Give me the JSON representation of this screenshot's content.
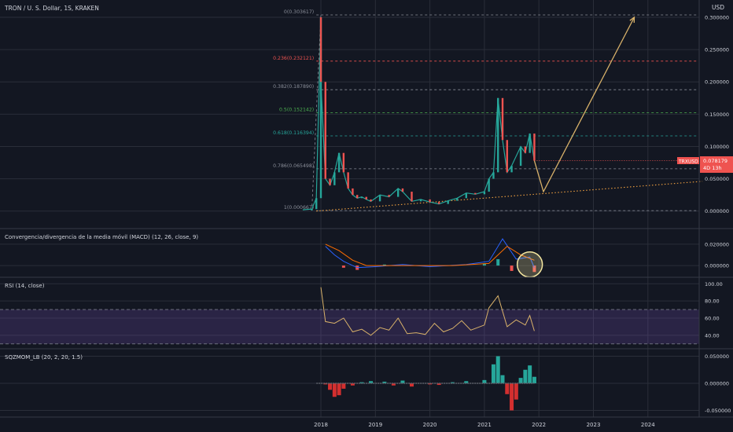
{
  "header": {
    "symbol_title": "TRON / U. S. Dollar, 1S, KRAKEN",
    "currency": "USD"
  },
  "price_badge": {
    "ticker": "TRXUSD",
    "price": "0.078179",
    "countdown": "4D 13h"
  },
  "colors": {
    "background": "#131722",
    "grid": "#2a2e39",
    "candle_up": "#26a69a",
    "candle_down": "#ef5350",
    "projection": "#d9b26a",
    "trendline": "#f0a040",
    "fib_default": "#8a8e99",
    "fib_0236": "#ef5350",
    "fib_05": "#4caf50",
    "fib_0618": "#26a69a",
    "macd_line": "#2962ff",
    "signal_line": "#ff6d00",
    "rsi_line": "#d9b26a",
    "rsi_band": "#7e57c2",
    "mom_up": "#26a69a",
    "mom_down": "#d32f2f",
    "highlight_circle": "#f5e7a0"
  },
  "chart_data": [
    {
      "type": "line",
      "pane": "price",
      "title": "TRON / U. S. Dollar, 1S, KRAKEN",
      "yaxis_ticks": [
        "0.300000",
        "0.250000",
        "0.200000",
        "0.150000",
        "0.100000",
        "0.050000",
        "0.000000"
      ],
      "ylim": [
        -0.004,
        0.3
      ],
      "x_ticks": [
        "2018",
        "2019",
        "2020",
        "2021",
        "2022",
        "2023",
        "2024"
      ],
      "fib_levels": [
        {
          "ratio": "0",
          "price": 0.303617,
          "label": "0(0.303617)",
          "color": "#8a8e99"
        },
        {
          "ratio": "0.236",
          "price": 0.232121,
          "label": "0.236(0.232121)",
          "color": "#ef5350"
        },
        {
          "ratio": "0.382",
          "price": 0.18789,
          "label": "0.382(0.187890)",
          "color": "#8a8e99"
        },
        {
          "ratio": "0.5",
          "price": 0.152142,
          "label": "0.5(0.152142)",
          "color": "#4caf50"
        },
        {
          "ratio": "0.618",
          "price": 0.116394,
          "label": "0.618(0.116394)",
          "color": "#26a69a"
        },
        {
          "ratio": "0.786",
          "price": 0.065498,
          "label": "0.786(0.065498)",
          "color": "#8a8e99"
        },
        {
          "ratio": "1",
          "price": 0.000667,
          "label": "1(0.000667)",
          "color": "#8a8e99"
        }
      ],
      "price_path": [
        [
          "2017-09",
          0.002
        ],
        [
          "2017-11",
          0.003
        ],
        [
          "2017-12",
          0.02
        ],
        [
          "2018-01",
          0.3
        ],
        [
          "2018-01",
          0.2
        ],
        [
          "2018-02",
          0.05
        ],
        [
          "2018-03",
          0.04
        ],
        [
          "2018-04",
          0.06
        ],
        [
          "2018-05",
          0.09
        ],
        [
          "2018-06",
          0.06
        ],
        [
          "2018-07",
          0.035
        ],
        [
          "2018-08",
          0.025
        ],
        [
          "2018-09",
          0.02
        ],
        [
          "2018-10",
          0.022
        ],
        [
          "2018-11",
          0.018
        ],
        [
          "2018-12",
          0.015
        ],
        [
          "2019-02",
          0.025
        ],
        [
          "2019-04",
          0.022
        ],
        [
          "2019-06",
          0.035
        ],
        [
          "2019-07",
          0.03
        ],
        [
          "2019-09",
          0.015
        ],
        [
          "2019-11",
          0.018
        ],
        [
          "2020-01",
          0.014
        ],
        [
          "2020-03",
          0.011
        ],
        [
          "2020-05",
          0.016
        ],
        [
          "2020-07",
          0.02
        ],
        [
          "2020-09",
          0.028
        ],
        [
          "2020-11",
          0.026
        ],
        [
          "2021-01",
          0.03
        ],
        [
          "2021-02",
          0.05
        ],
        [
          "2021-03",
          0.06
        ],
        [
          "2021-04",
          0.175
        ],
        [
          "2021-05",
          0.11
        ],
        [
          "2021-06",
          0.06
        ],
        [
          "2021-07",
          0.07
        ],
        [
          "2021-09",
          0.1
        ],
        [
          "2021-10",
          0.09
        ],
        [
          "2021-11",
          0.12
        ],
        [
          "2021-12",
          0.078
        ]
      ],
      "projection": [
        [
          "2021-12",
          0.078
        ],
        [
          "2022-02",
          0.03
        ],
        [
          "2023-10",
          0.3
        ]
      ],
      "trendline": [
        [
          "2017-12",
          0.0
        ],
        [
          "2025-01",
          0.046
        ]
      ],
      "last_price": 0.078179
    },
    {
      "type": "line",
      "pane": "macd",
      "title": "Convergencia/divergencia de la media móvil (MACD) (12, 26, close, 9)",
      "yaxis_ticks": [
        "0.020000",
        "0.000000"
      ],
      "ylim": [
        -0.008,
        0.028
      ],
      "series": [
        {
          "name": "MACD",
          "values": [
            [
              "2018-02",
              0.018
            ],
            [
              "2018-04",
              0.01
            ],
            [
              "2018-06",
              0.004
            ],
            [
              "2018-09",
              -0.002
            ],
            [
              "2019-01",
              -0.001
            ],
            [
              "2019-07",
              0.001
            ],
            [
              "2020-01",
              -0.001
            ],
            [
              "2020-09",
              0.001
            ],
            [
              "2021-02",
              0.004
            ],
            [
              "2021-05",
              0.025
            ],
            [
              "2021-08",
              0.006
            ],
            [
              "2021-11",
              0.008
            ],
            [
              "2021-12",
              -0.002
            ]
          ]
        },
        {
          "name": "Signal",
          "values": [
            [
              "2018-02",
              0.02
            ],
            [
              "2018-05",
              0.014
            ],
            [
              "2018-08",
              0.005
            ],
            [
              "2018-11",
              0.0
            ],
            [
              "2019-06",
              0.0
            ],
            [
              "2020-06",
              0.0
            ],
            [
              "2021-02",
              0.002
            ],
            [
              "2021-06",
              0.018
            ],
            [
              "2021-09",
              0.01
            ],
            [
              "2021-12",
              0.005
            ]
          ]
        }
      ],
      "histogram": [
        [
          "2018-06",
          -0.002
        ],
        [
          "2018-09",
          -0.004
        ],
        [
          "2019-03",
          0.001
        ],
        [
          "2020-06",
          0.0005
        ],
        [
          "2021-01",
          0.002
        ],
        [
          "2021-04",
          0.006
        ],
        [
          "2021-07",
          -0.005
        ],
        [
          "2021-12",
          -0.006
        ]
      ]
    },
    {
      "type": "line",
      "pane": "rsi",
      "title": "RSI (14, close)",
      "yaxis_ticks": [
        "100.00",
        "80.00",
        "60.00",
        "40.00"
      ],
      "ylim": [
        28,
        103
      ],
      "band": [
        30,
        70
      ],
      "values": [
        [
          "2018-01",
          96
        ],
        [
          "2018-02",
          56
        ],
        [
          "2018-04",
          54
        ],
        [
          "2018-06",
          60
        ],
        [
          "2018-08",
          44
        ],
        [
          "2018-10",
          47
        ],
        [
          "2018-12",
          40
        ],
        [
          "2019-02",
          49
        ],
        [
          "2019-04",
          46
        ],
        [
          "2019-06",
          60
        ],
        [
          "2019-08",
          42
        ],
        [
          "2019-10",
          43
        ],
        [
          "2019-12",
          41
        ],
        [
          "2020-02",
          54
        ],
        [
          "2020-04",
          44
        ],
        [
          "2020-06",
          48
        ],
        [
          "2020-08",
          57
        ],
        [
          "2020-10",
          46
        ],
        [
          "2021-01",
          52
        ],
        [
          "2021-02",
          72
        ],
        [
          "2021-04",
          86
        ],
        [
          "2021-06",
          50
        ],
        [
          "2021-08",
          58
        ],
        [
          "2021-10",
          52
        ],
        [
          "2021-11",
          63
        ],
        [
          "2021-12",
          45
        ]
      ]
    },
    {
      "type": "bar",
      "pane": "momentum",
      "title": "SQZMOM_LB (20, 2, 20, 1.5)",
      "yaxis_ticks": [
        "0.050000",
        "0.000000",
        "-0.050000"
      ],
      "ylim": [
        -0.058,
        0.058
      ],
      "values": [
        [
          "2018-02",
          -0.002
        ],
        [
          "2018-03",
          -0.012
        ],
        [
          "2018-04",
          -0.025
        ],
        [
          "2018-05",
          -0.022
        ],
        [
          "2018-06",
          -0.01
        ],
        [
          "2018-08",
          -0.004
        ],
        [
          "2018-10",
          0.002
        ],
        [
          "2018-12",
          0.004
        ],
        [
          "2019-03",
          0.003
        ],
        [
          "2019-05",
          -0.004
        ],
        [
          "2019-07",
          0.005
        ],
        [
          "2019-09",
          -0.006
        ],
        [
          "2020-01",
          -0.002
        ],
        [
          "2020-03",
          -0.003
        ],
        [
          "2020-06",
          0.002
        ],
        [
          "2020-09",
          0.004
        ],
        [
          "2021-01",
          0.006
        ],
        [
          "2021-03",
          0.035
        ],
        [
          "2021-04",
          0.05
        ],
        [
          "2021-05",
          0.015
        ],
        [
          "2021-06",
          -0.02
        ],
        [
          "2021-07",
          -0.05
        ],
        [
          "2021-08",
          -0.03
        ],
        [
          "2021-09",
          0.01
        ],
        [
          "2021-10",
          0.025
        ],
        [
          "2021-11",
          0.033
        ],
        [
          "2021-12",
          0.012
        ]
      ]
    }
  ]
}
